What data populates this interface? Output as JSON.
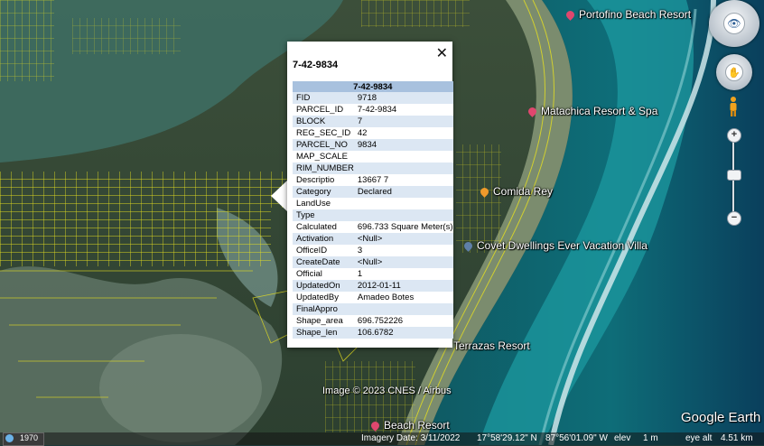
{
  "places": [
    {
      "name": "Portofino Beach Resort",
      "color": "#e0476e"
    },
    {
      "name": "Matachica Resort & Spa",
      "color": "#e0476e"
    },
    {
      "name": "Comida Rey",
      "color": "#f09a2b"
    },
    {
      "name": "Covet Dwellings Ever Vacation Villa",
      "color": "#5f7fa8"
    },
    {
      "name": "Terrazas Resort",
      "color": "#e0476e"
    },
    {
      "name": "Beach Resort",
      "color": "#e0476e"
    }
  ],
  "credit": "Image © 2023 CNES / Airbus",
  "logo": "Google Earth",
  "popup": {
    "title": "7-42-9834",
    "table_header": "7-42-9834",
    "close_label": "✕",
    "rows": [
      {
        "key": "FID",
        "value": "9718"
      },
      {
        "key": "PARCEL_ID",
        "value": "7-42-9834"
      },
      {
        "key": "BLOCK",
        "value": "7"
      },
      {
        "key": "REG_SEC_ID",
        "value": "42"
      },
      {
        "key": "PARCEL_NO",
        "value": "9834"
      },
      {
        "key": "MAP_SCALE",
        "value": ""
      },
      {
        "key": "RIM_NUMBER",
        "value": ""
      },
      {
        "key": "Descriptio",
        "value": "13667 7"
      },
      {
        "key": "Category",
        "value": "Declared"
      },
      {
        "key": "LandUse",
        "value": ""
      },
      {
        "key": "Type",
        "value": ""
      },
      {
        "key": "Calculated",
        "value": "696.733 Square Meter(s)"
      },
      {
        "key": "Activation",
        "value": "<Null>"
      },
      {
        "key": "OfficeID",
        "value": "3"
      },
      {
        "key": "CreateDate",
        "value": "<Null>"
      },
      {
        "key": "Official",
        "value": "1"
      },
      {
        "key": "UpdatedOn",
        "value": "2012-01-11"
      },
      {
        "key": "UpdatedBy",
        "value": "Amadeo Botes"
      },
      {
        "key": "FinalAppro",
        "value": ""
      },
      {
        "key": "Shape_area",
        "value": "696.752226"
      },
      {
        "key": "Shape_len",
        "value": "106.6782"
      }
    ]
  },
  "statusbar": {
    "year": "1970",
    "imagery_date": "Imagery Date: 3/11/2022",
    "lat": "17°58'29.12\" N",
    "lon": "87°56'01.09\" W",
    "elev_label": "elev",
    "elev_value": "1 m",
    "eye_alt": "eye alt",
    "eye_alt_value": "4.51 km"
  },
  "controls": {
    "zoom_in": "+",
    "zoom_out": "−"
  }
}
